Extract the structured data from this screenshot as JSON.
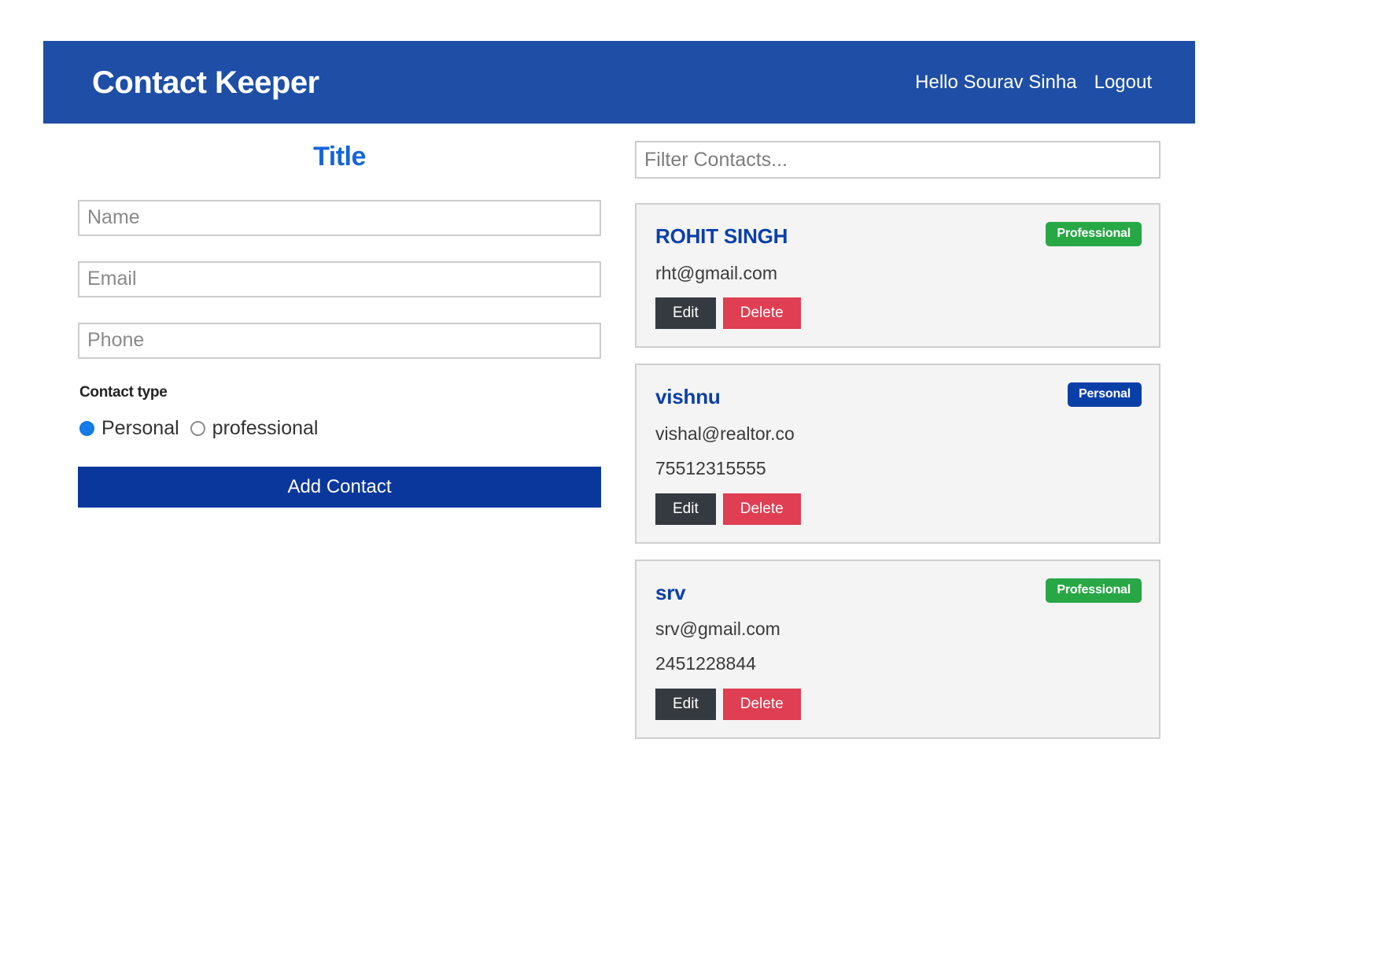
{
  "navbar": {
    "brand": "Contact Keeper",
    "greeting": "Hello Sourav Sinha",
    "logout_label": "Logout"
  },
  "form": {
    "title": "Title",
    "name_placeholder": "Name",
    "name_value": "",
    "email_placeholder": "Email",
    "email_value": "",
    "phone_placeholder": "Phone",
    "phone_value": "",
    "contact_type_legend": "Contact type",
    "radio_personal_label": "Personal",
    "radio_professional_label": "professional",
    "selected_type": "Personal",
    "submit_label": "Add Contact"
  },
  "filter": {
    "placeholder": "Filter Contacts...",
    "value": ""
  },
  "contacts": [
    {
      "name": "ROHIT SINGH",
      "badge": "Professional",
      "badge_color": "#28a745",
      "email": "rht@gmail.com",
      "phone": "",
      "edit_label": "Edit",
      "delete_label": "Delete"
    },
    {
      "name": "vishnu",
      "badge": "Personal",
      "badge_color": "#0b3fa8",
      "email": "vishal@realtor.co",
      "phone": "75512315555",
      "edit_label": "Edit",
      "delete_label": "Delete"
    },
    {
      "name": "srv",
      "badge": "Professional",
      "badge_color": "#28a745",
      "email": "srv@gmail.com",
      "phone": "2451228844",
      "edit_label": "Edit",
      "delete_label": "Delete"
    }
  ],
  "colors": {
    "navbar_bg": "#1e4ea5",
    "primary_btn": "#0a379c",
    "title_blue": "#1565d8",
    "card_bg": "#f4f4f4",
    "edit_btn": "#343a40",
    "delete_btn": "#e03e52"
  }
}
